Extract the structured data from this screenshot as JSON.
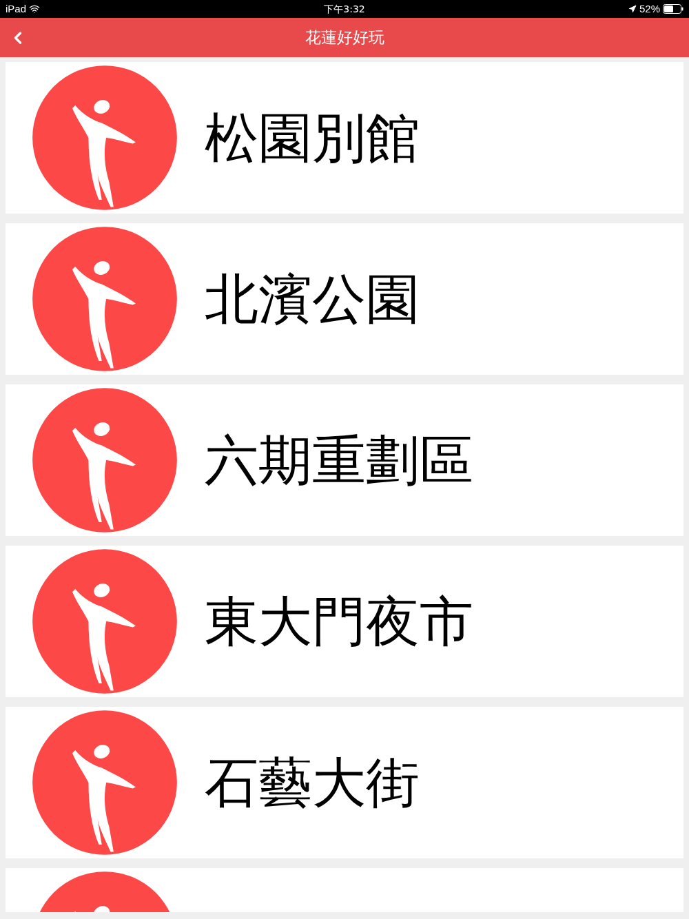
{
  "status_bar": {
    "device": "iPad",
    "time": "下午3:32",
    "battery": "52%"
  },
  "nav_bar": {
    "title": "花蓮好好玩"
  },
  "places": [
    {
      "name": "松園別館"
    },
    {
      "name": "北濱公園"
    },
    {
      "name": "六期重劃區"
    },
    {
      "name": "東大門夜市"
    },
    {
      "name": "石藝大街"
    }
  ],
  "cut_off_row": true
}
